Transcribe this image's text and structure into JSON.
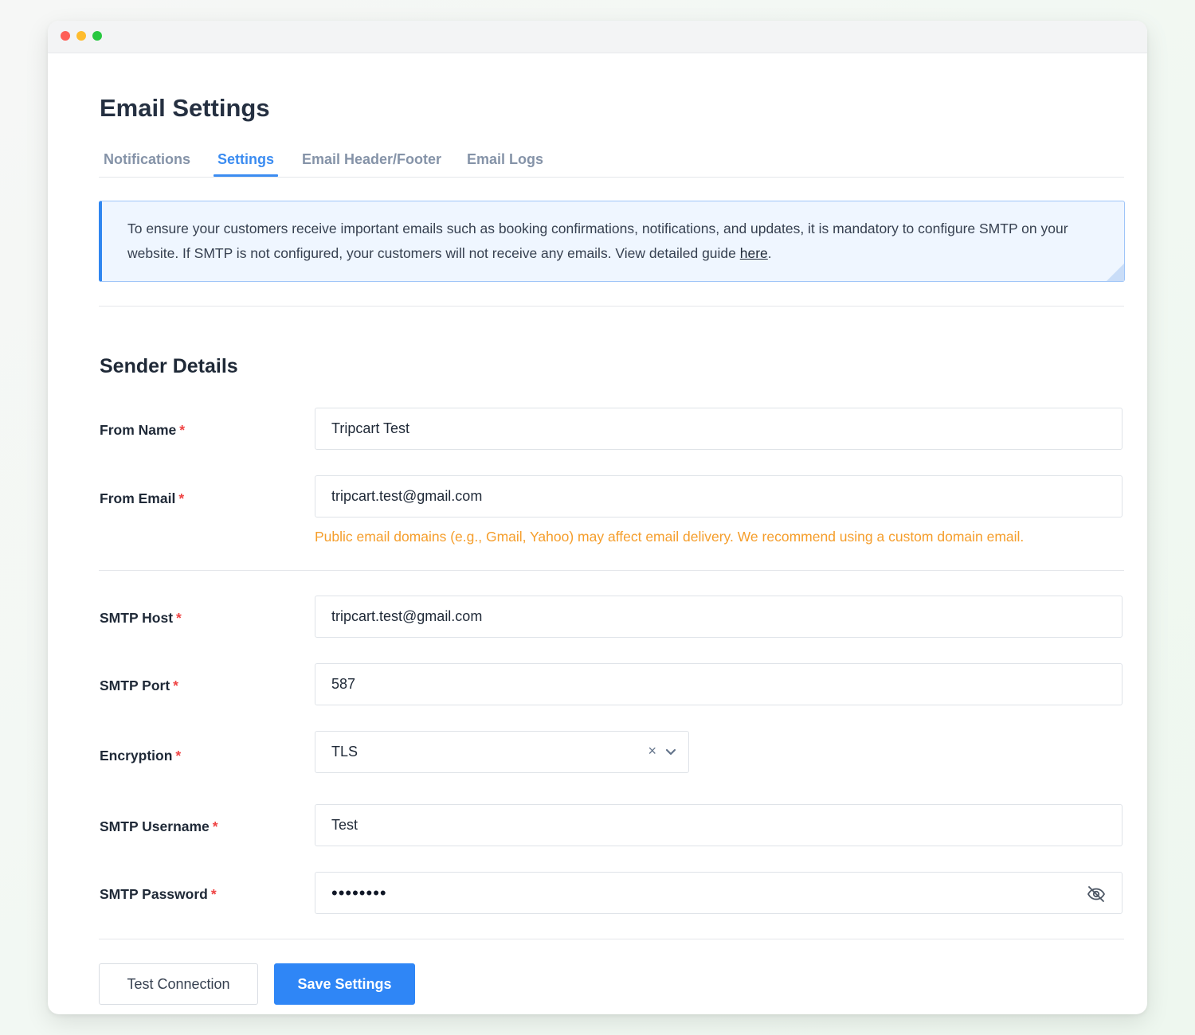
{
  "page": {
    "title": "Email Settings"
  },
  "tabs": [
    {
      "label": "Notifications",
      "active": false
    },
    {
      "label": "Settings",
      "active": true
    },
    {
      "label": "Email Header/Footer",
      "active": false
    },
    {
      "label": "Email Logs",
      "active": false
    }
  ],
  "notice": {
    "text": "To ensure your customers receive important emails such as booking confirmations, notifications, and updates, it is mandatory to configure SMTP on your website. If SMTP is not configured, your customers will not receive any emails. View detailed guide ",
    "link_text": "here",
    "trailing": "."
  },
  "section": {
    "title": "Sender Details"
  },
  "form": {
    "required_marker": "*",
    "from_name": {
      "label": "From Name",
      "value": "Tripcart Test"
    },
    "from_email": {
      "label": "From Email",
      "value": "tripcart.test@gmail.com",
      "hint": "Public email domains (e.g., Gmail, Yahoo) may affect email delivery. We recommend using a custom domain email."
    },
    "smtp_host": {
      "label": "SMTP Host",
      "value": "tripcart.test@gmail.com"
    },
    "smtp_port": {
      "label": "SMTP Port",
      "value": "587"
    },
    "encryption": {
      "label": "Encryption",
      "value": "TLS",
      "clear_glyph": "×"
    },
    "smtp_username": {
      "label": "SMTP Username",
      "value": "Test"
    },
    "smtp_password": {
      "label": "SMTP Password",
      "masked_value": "••••••••"
    }
  },
  "actions": {
    "test_connection": "Test Connection",
    "save_settings": "Save Settings"
  },
  "icons": {
    "encryption_toggle": "chevron-down-icon",
    "password_visibility": "eye-off-icon"
  },
  "colors": {
    "accent": "#3b8cf1",
    "primary_button": "#2f86f6",
    "required": "#ef4444",
    "warning": "#f59e2c",
    "notice_bg": "#eff6ff"
  }
}
